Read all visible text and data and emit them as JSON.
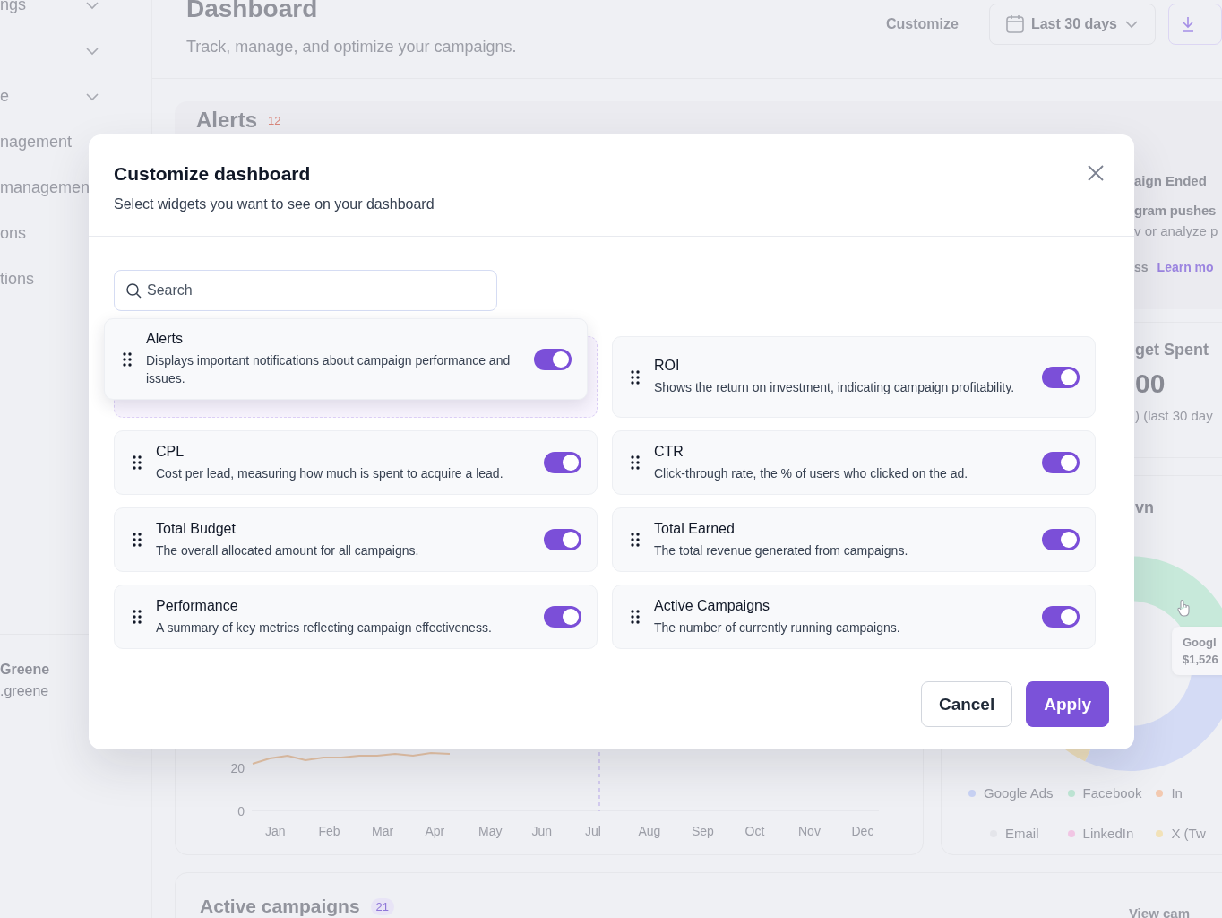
{
  "sidebar": {
    "items": [
      {
        "label": "ngs",
        "chevron": true
      },
      {
        "chevron": true
      },
      {
        "label": "e",
        "chevron": true
      },
      {
        "label": "nagement",
        "chevron": false
      },
      {
        "label": "managemen",
        "chevron": false
      },
      {
        "label": "ons",
        "chevron": false
      },
      {
        "label": "tions",
        "chevron": false
      }
    ],
    "user": {
      "name": "Greene",
      "handle": ".greene"
    }
  },
  "header": {
    "title": "Dashboard",
    "subtitle": "Track, manage, and optimize your campaigns.",
    "customize": "Customize",
    "date_range": "Last 30 days"
  },
  "alerts": {
    "title": "Alerts",
    "count": "12",
    "item_title": "aign Ended",
    "item_message_bold": "gram pushes",
    "item_message": "v or analyze p",
    "item_action": "ss",
    "item_link": "Learn mo"
  },
  "budget": {
    "title": "get Spent",
    "value": "00",
    "note": ") (last 30 day"
  },
  "chart": {
    "y_labels": [
      "20",
      "0"
    ],
    "months": [
      "Jan",
      "Feb",
      "Mar",
      "Apr",
      "May",
      "Jun",
      "Jul",
      "Aug",
      "Sep",
      "Oct",
      "Nov",
      "Dec"
    ]
  },
  "breakdown": {
    "title": "vn",
    "tooltip": {
      "label": "Googl",
      "value": "$1,526"
    },
    "legend": [
      {
        "label": "Google Ads",
        "color": "#c9d3f5"
      },
      {
        "label": "Facebook",
        "color": "#bfe6d5"
      },
      {
        "label": "In",
        "color": "#f3c9b0"
      },
      {
        "label": "Email",
        "color": "#e4e5ea"
      },
      {
        "label": "LinkedIn",
        "color": "#f1c6e4"
      },
      {
        "label": "X (Tw",
        "color": "#f2e2b8"
      }
    ]
  },
  "active_campaigns": {
    "title": "Active campaigns",
    "count": "21",
    "link": "View cam"
  },
  "modal": {
    "title": "Customize dashboard",
    "subtitle": "Select widgets you want to see on your dashboard",
    "search": {
      "placeholder": "Search"
    },
    "widgets": [
      {
        "title": "Alerts",
        "description": "Displays important notifications about campaign performance and issues.",
        "on": true,
        "dragging": true
      },
      {
        "title": "ROI",
        "description": "Shows the return on investment, indicating campaign profitability.",
        "on": true,
        "dragging": false
      },
      {
        "title": "CPL",
        "description": "Cost per lead, measuring how much is spent to acquire a lead.",
        "on": true,
        "dragging": false
      },
      {
        "title": "CTR",
        "description": "Click-through rate, the % of users who clicked on the ad.",
        "on": true,
        "dragging": false
      },
      {
        "title": "Total Budget",
        "description": "The overall allocated amount for all campaigns.",
        "on": true,
        "dragging": false
      },
      {
        "title": "Total Earned",
        "description": "The total revenue generated from campaigns.",
        "on": true,
        "dragging": false
      },
      {
        "title": "Performance",
        "description": "A summary of key metrics reflecting campaign effectiveness.",
        "on": true,
        "dragging": false
      },
      {
        "title": "Active Campaigns",
        "description": "The number of currently running campaigns.",
        "on": true,
        "dragging": false
      }
    ],
    "cancel": "Cancel",
    "apply": "Apply"
  }
}
